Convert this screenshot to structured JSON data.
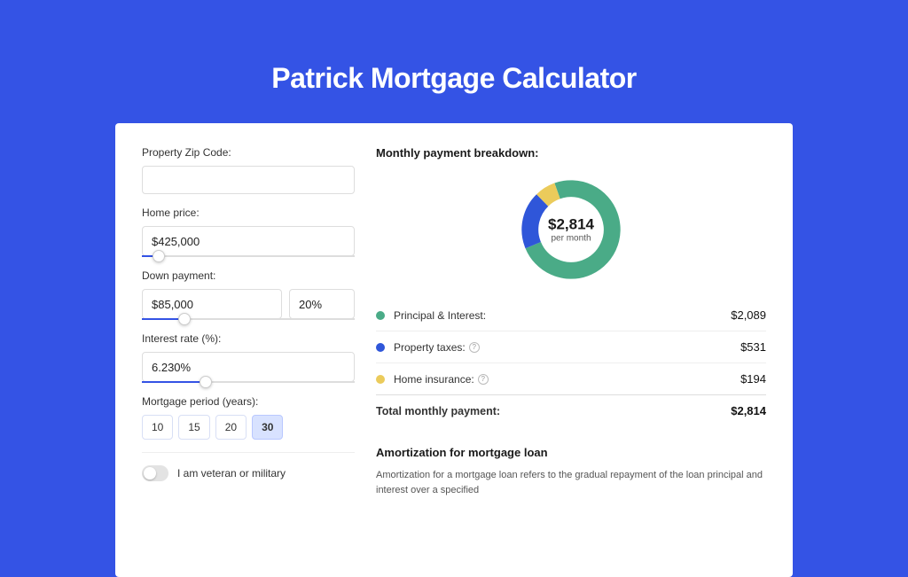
{
  "title": "Patrick Mortgage Calculator",
  "inputs": {
    "zip": {
      "label": "Property Zip Code:",
      "value": ""
    },
    "price": {
      "label": "Home price:",
      "value": "$425,000",
      "slider_pct": 8
    },
    "down": {
      "label": "Down payment:",
      "amount": "$85,000",
      "percent": "20%",
      "slider_pct": 20
    },
    "rate": {
      "label": "Interest rate (%):",
      "value": "6.230%",
      "slider_pct": 30
    },
    "period": {
      "label": "Mortgage period (years):",
      "options": [
        "10",
        "15",
        "20",
        "30"
      ],
      "selected": "30"
    },
    "veteran": {
      "label": "I am veteran or military",
      "on": false
    }
  },
  "breakdown": {
    "title": "Monthly payment breakdown:",
    "total_big": "$2,814",
    "total_sub": "per month",
    "items": [
      {
        "label": "Principal & Interest:",
        "value": "$2,089",
        "color": "#4aab87",
        "info": false
      },
      {
        "label": "Property taxes:",
        "value": "$531",
        "color": "#2f56d9",
        "info": true
      },
      {
        "label": "Home insurance:",
        "value": "$194",
        "color": "#ebcb5b",
        "info": true
      }
    ],
    "total_row": {
      "label": "Total monthly payment:",
      "value": "$2,814"
    }
  },
  "chart_data": {
    "type": "pie",
    "title": "Monthly payment breakdown",
    "unit": "$ per month",
    "series": [
      {
        "name": "Principal & Interest",
        "value": 2089,
        "color": "#4aab87"
      },
      {
        "name": "Property taxes",
        "value": 531,
        "color": "#2f56d9"
      },
      {
        "name": "Home insurance",
        "value": 194,
        "color": "#ebcb5b"
      }
    ],
    "total": 2814,
    "center_label": "$2,814 per month"
  },
  "amortization": {
    "title": "Amortization for mortgage loan",
    "text": "Amortization for a mortgage loan refers to the gradual repayment of the loan principal and interest over a specified"
  }
}
